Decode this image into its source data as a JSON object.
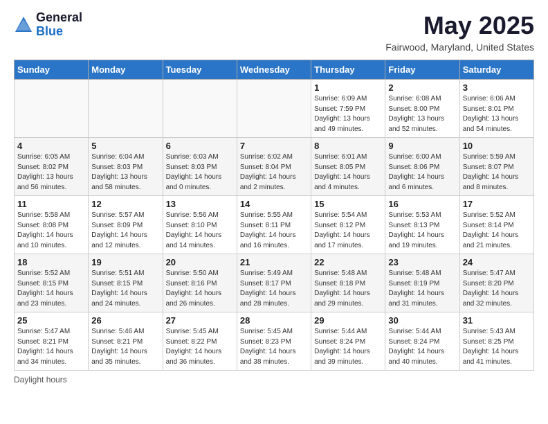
{
  "header": {
    "logo_general": "General",
    "logo_blue": "Blue",
    "month_title": "May 2025",
    "location": "Fairwood, Maryland, United States"
  },
  "days_of_week": [
    "Sunday",
    "Monday",
    "Tuesday",
    "Wednesday",
    "Thursday",
    "Friday",
    "Saturday"
  ],
  "footer": "Daylight hours",
  "weeks": [
    [
      {
        "day": "",
        "info": ""
      },
      {
        "day": "",
        "info": ""
      },
      {
        "day": "",
        "info": ""
      },
      {
        "day": "",
        "info": ""
      },
      {
        "day": "1",
        "info": "Sunrise: 6:09 AM\nSunset: 7:59 PM\nDaylight: 13 hours\nand 49 minutes."
      },
      {
        "day": "2",
        "info": "Sunrise: 6:08 AM\nSunset: 8:00 PM\nDaylight: 13 hours\nand 52 minutes."
      },
      {
        "day": "3",
        "info": "Sunrise: 6:06 AM\nSunset: 8:01 PM\nDaylight: 13 hours\nand 54 minutes."
      }
    ],
    [
      {
        "day": "4",
        "info": "Sunrise: 6:05 AM\nSunset: 8:02 PM\nDaylight: 13 hours\nand 56 minutes."
      },
      {
        "day": "5",
        "info": "Sunrise: 6:04 AM\nSunset: 8:03 PM\nDaylight: 13 hours\nand 58 minutes."
      },
      {
        "day": "6",
        "info": "Sunrise: 6:03 AM\nSunset: 8:03 PM\nDaylight: 14 hours\nand 0 minutes."
      },
      {
        "day": "7",
        "info": "Sunrise: 6:02 AM\nSunset: 8:04 PM\nDaylight: 14 hours\nand 2 minutes."
      },
      {
        "day": "8",
        "info": "Sunrise: 6:01 AM\nSunset: 8:05 PM\nDaylight: 14 hours\nand 4 minutes."
      },
      {
        "day": "9",
        "info": "Sunrise: 6:00 AM\nSunset: 8:06 PM\nDaylight: 14 hours\nand 6 minutes."
      },
      {
        "day": "10",
        "info": "Sunrise: 5:59 AM\nSunset: 8:07 PM\nDaylight: 14 hours\nand 8 minutes."
      }
    ],
    [
      {
        "day": "11",
        "info": "Sunrise: 5:58 AM\nSunset: 8:08 PM\nDaylight: 14 hours\nand 10 minutes."
      },
      {
        "day": "12",
        "info": "Sunrise: 5:57 AM\nSunset: 8:09 PM\nDaylight: 14 hours\nand 12 minutes."
      },
      {
        "day": "13",
        "info": "Sunrise: 5:56 AM\nSunset: 8:10 PM\nDaylight: 14 hours\nand 14 minutes."
      },
      {
        "day": "14",
        "info": "Sunrise: 5:55 AM\nSunset: 8:11 PM\nDaylight: 14 hours\nand 16 minutes."
      },
      {
        "day": "15",
        "info": "Sunrise: 5:54 AM\nSunset: 8:12 PM\nDaylight: 14 hours\nand 17 minutes."
      },
      {
        "day": "16",
        "info": "Sunrise: 5:53 AM\nSunset: 8:13 PM\nDaylight: 14 hours\nand 19 minutes."
      },
      {
        "day": "17",
        "info": "Sunrise: 5:52 AM\nSunset: 8:14 PM\nDaylight: 14 hours\nand 21 minutes."
      }
    ],
    [
      {
        "day": "18",
        "info": "Sunrise: 5:52 AM\nSunset: 8:15 PM\nDaylight: 14 hours\nand 23 minutes."
      },
      {
        "day": "19",
        "info": "Sunrise: 5:51 AM\nSunset: 8:15 PM\nDaylight: 14 hours\nand 24 minutes."
      },
      {
        "day": "20",
        "info": "Sunrise: 5:50 AM\nSunset: 8:16 PM\nDaylight: 14 hours\nand 26 minutes."
      },
      {
        "day": "21",
        "info": "Sunrise: 5:49 AM\nSunset: 8:17 PM\nDaylight: 14 hours\nand 28 minutes."
      },
      {
        "day": "22",
        "info": "Sunrise: 5:48 AM\nSunset: 8:18 PM\nDaylight: 14 hours\nand 29 minutes."
      },
      {
        "day": "23",
        "info": "Sunrise: 5:48 AM\nSunset: 8:19 PM\nDaylight: 14 hours\nand 31 minutes."
      },
      {
        "day": "24",
        "info": "Sunrise: 5:47 AM\nSunset: 8:20 PM\nDaylight: 14 hours\nand 32 minutes."
      }
    ],
    [
      {
        "day": "25",
        "info": "Sunrise: 5:47 AM\nSunset: 8:21 PM\nDaylight: 14 hours\nand 34 minutes."
      },
      {
        "day": "26",
        "info": "Sunrise: 5:46 AM\nSunset: 8:21 PM\nDaylight: 14 hours\nand 35 minutes."
      },
      {
        "day": "27",
        "info": "Sunrise: 5:45 AM\nSunset: 8:22 PM\nDaylight: 14 hours\nand 36 minutes."
      },
      {
        "day": "28",
        "info": "Sunrise: 5:45 AM\nSunset: 8:23 PM\nDaylight: 14 hours\nand 38 minutes."
      },
      {
        "day": "29",
        "info": "Sunrise: 5:44 AM\nSunset: 8:24 PM\nDaylight: 14 hours\nand 39 minutes."
      },
      {
        "day": "30",
        "info": "Sunrise: 5:44 AM\nSunset: 8:24 PM\nDaylight: 14 hours\nand 40 minutes."
      },
      {
        "day": "31",
        "info": "Sunrise: 5:43 AM\nSunset: 8:25 PM\nDaylight: 14 hours\nand 41 minutes."
      }
    ]
  ]
}
